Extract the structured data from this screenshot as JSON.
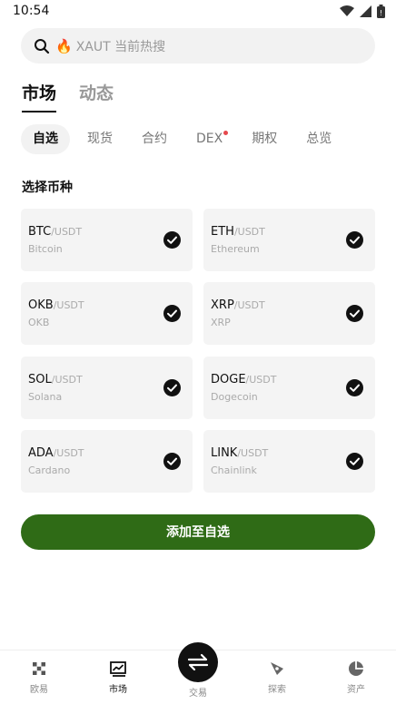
{
  "status": {
    "time": "10:54"
  },
  "search": {
    "placeholder": "XAUT 当前热搜"
  },
  "main_tabs": [
    {
      "label": "市场",
      "active": true
    },
    {
      "label": "动态",
      "active": false
    }
  ],
  "sub_tabs": [
    {
      "label": "自选",
      "active": true
    },
    {
      "label": "现货"
    },
    {
      "label": "合约"
    },
    {
      "label": "DEX",
      "dot": true
    },
    {
      "label": "期权"
    },
    {
      "label": "总览"
    }
  ],
  "section_title": "选择币种",
  "coins": [
    {
      "symbol": "BTC",
      "quote": "/USDT",
      "name": "Bitcoin",
      "checked": true
    },
    {
      "symbol": "ETH",
      "quote": "/USDT",
      "name": "Ethereum",
      "checked": true
    },
    {
      "symbol": "OKB",
      "quote": "/USDT",
      "name": "OKB",
      "checked": true
    },
    {
      "symbol": "XRP",
      "quote": "/USDT",
      "name": "XRP",
      "checked": true
    },
    {
      "symbol": "SOL",
      "quote": "/USDT",
      "name": "Solana",
      "checked": true
    },
    {
      "symbol": "DOGE",
      "quote": "/USDT",
      "name": "Dogecoin",
      "checked": true
    },
    {
      "symbol": "ADA",
      "quote": "/USDT",
      "name": "Cardano",
      "checked": true
    },
    {
      "symbol": "LINK",
      "quote": "/USDT",
      "name": "Chainlink",
      "checked": true
    }
  ],
  "add_button": "添加至自选",
  "bottom_nav": [
    {
      "label": "欧易",
      "icon": "okx-logo-icon"
    },
    {
      "label": "市场",
      "icon": "market-chart-icon",
      "active": true
    },
    {
      "label": "交易",
      "icon": "swap-arrows-icon"
    },
    {
      "label": "探索",
      "icon": "compass-icon"
    },
    {
      "label": "资产",
      "icon": "pie-chart-icon"
    }
  ],
  "colors": {
    "accent": "#2f6b16",
    "dot": "#e5484d"
  }
}
